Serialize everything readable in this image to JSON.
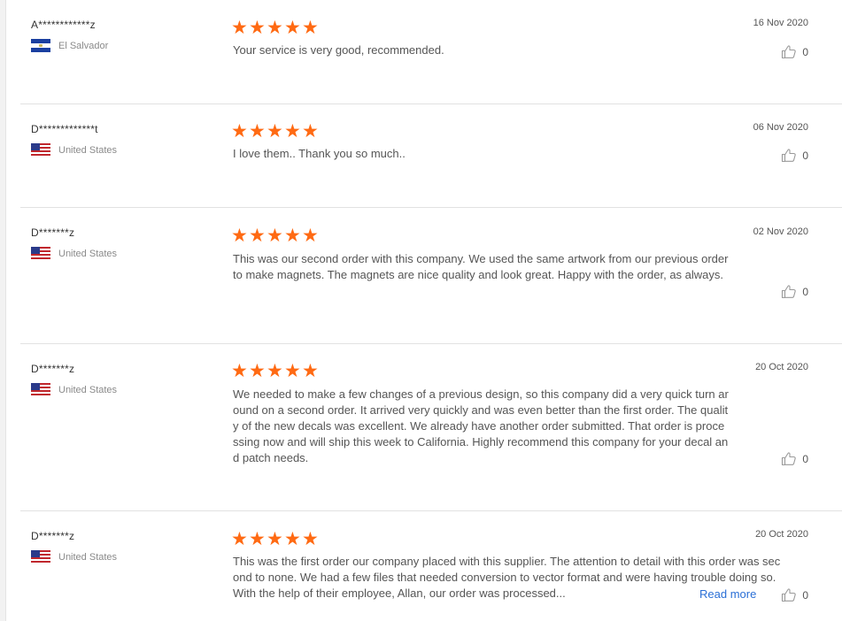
{
  "reviews": [
    {
      "name": "A************z",
      "country": "El Salvador",
      "flag": "sv",
      "rating": 5,
      "text": "Your service is very good, recommended.",
      "date": "16 Nov 2020",
      "likes": "0"
    },
    {
      "name": "D*************t",
      "country": "United States",
      "flag": "us",
      "rating": 5,
      "text": "I love them.. Thank you so much..",
      "date": "06 Nov 2020",
      "likes": "0"
    },
    {
      "name": "D*******z",
      "country": "United States",
      "flag": "us",
      "rating": 5,
      "text": "This was our second order with this company. We used the same artwork from our previous order to make magnets. The magnets are nice quality and look great. Happy with the order, as always.",
      "date": "02 Nov 2020",
      "likes": "0"
    },
    {
      "name": "D*******z",
      "country": "United States",
      "flag": "us",
      "rating": 5,
      "text": "We needed to make a few changes of a previous design, so this company did a very quick turn around on a second order. It arrived very quickly and was even better than the first order. The quality of the new decals was excellent. We already have another order submitted. That order is processing now and will ship this week to California. Highly recommend this company for your decal and patch needs.",
      "date": "20 Oct 2020",
      "likes": "0"
    },
    {
      "name": "D*******z",
      "country": "United States",
      "flag": "us",
      "rating": 5,
      "text": "This was the first order our company placed with this supplier. The attention to detail with this order was second to none. We had a few files that needed conversion to vector format and were having trouble doing so. With the help of their employee, Allan, our order was processed...",
      "date": "20 Oct 2020",
      "likes": "0",
      "read_more": "Read more"
    }
  ],
  "colors": {
    "star": "#ff6a13",
    "link": "#2a6fd6",
    "divider": "#e2e2e2"
  }
}
